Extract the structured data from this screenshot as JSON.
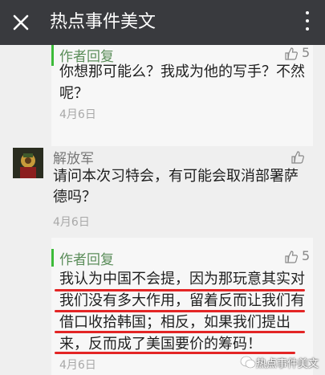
{
  "header": {
    "title": "热点事件美文"
  },
  "reply1": {
    "author": "作者回复",
    "likes": "5",
    "text": "你想那可能么？我成为他的写手？不然呢？",
    "date": "4月6日"
  },
  "comment": {
    "author": "解放军",
    "text": "请问本次习特会，有可能会取消部署萨德吗？",
    "date": "4月6日"
  },
  "reply2": {
    "author": "作者回复",
    "likes": "5",
    "text": "我认为中国不会提，因为那玩意其实对我们没有多大作用，留着反而让我们有借口收拾韩国；相反，如果我们提出来，反而成了美国要价的筹码！",
    "date": "4月6日"
  },
  "watermark": {
    "text": "热点事件美文"
  },
  "colors": {
    "topbar": "#393a3e",
    "accent_green": "#3dbb3a",
    "author_green": "#5b8d5a",
    "underline_red": "#e32525"
  },
  "icons": {
    "close": "close-icon",
    "more": "more-vertical-icon",
    "like": "thumbs-up-icon",
    "watermark": "wechat-icon"
  }
}
